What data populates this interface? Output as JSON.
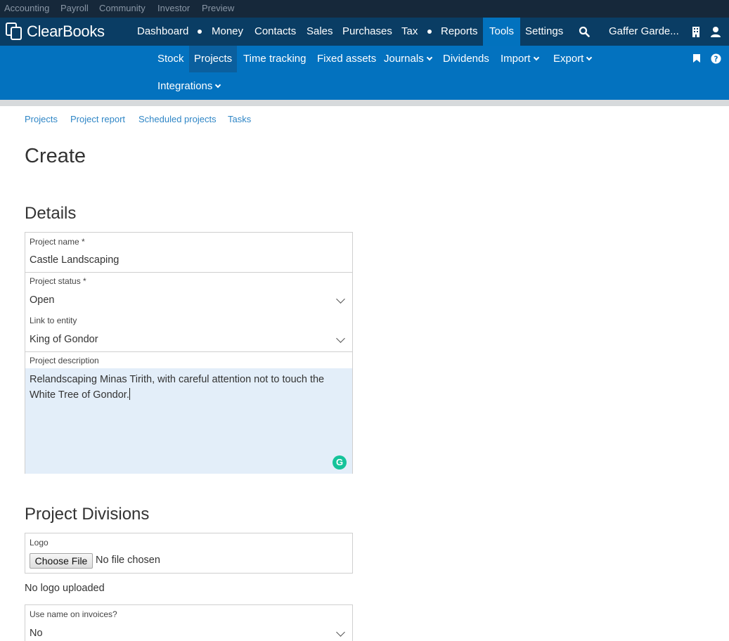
{
  "top_links": [
    "Accounting",
    "Payroll",
    "Community",
    "Investor",
    "Preview"
  ],
  "brand": "ClearBooks",
  "main_nav": {
    "dashboard": "Dashboard",
    "money": "Money",
    "contacts": "Contacts",
    "sales": "Sales",
    "purchases": "Purchases",
    "tax": "Tax",
    "reports": "Reports",
    "tools": "Tools",
    "settings": "Settings",
    "company": "Gaffer Garde..."
  },
  "sub_nav": {
    "stock": "Stock",
    "projects": "Projects",
    "time_tracking": "Time tracking",
    "fixed_assets": "Fixed assets",
    "journals": "Journals",
    "dividends": "Dividends",
    "import": "Import",
    "export": "Export",
    "integrations": "Integrations"
  },
  "tabs": [
    "Projects",
    "Project report",
    "Scheduled projects",
    "Tasks"
  ],
  "page_title": "Create",
  "details": {
    "heading": "Details",
    "project_name_label": "Project name *",
    "project_name_value": "Castle Landscaping",
    "status_label": "Project status *",
    "status_value": "Open",
    "entity_label": "Link to entity",
    "entity_value": "King of Gondor",
    "description_label": "Project description",
    "description_value": "Relandscaping Minas Tirith, with careful attention not to touch the White Tree of Gondor."
  },
  "divisions": {
    "heading": "Project Divisions",
    "logo_label": "Logo",
    "choose_file": "Choose File",
    "no_file": "No file chosen",
    "no_logo": "No logo uploaded",
    "use_name_label": "Use name on invoices?",
    "use_name_value": "No"
  },
  "grammarly_glyph": "G",
  "colors": {
    "topstrip": "#16283a",
    "main_nav": "#0a3d64",
    "sub_nav": "#0372bf",
    "active_tab": "#0272be",
    "link": "#2f86c6",
    "textarea_bg": "#e3eef9",
    "grammarly": "#15c39a"
  }
}
